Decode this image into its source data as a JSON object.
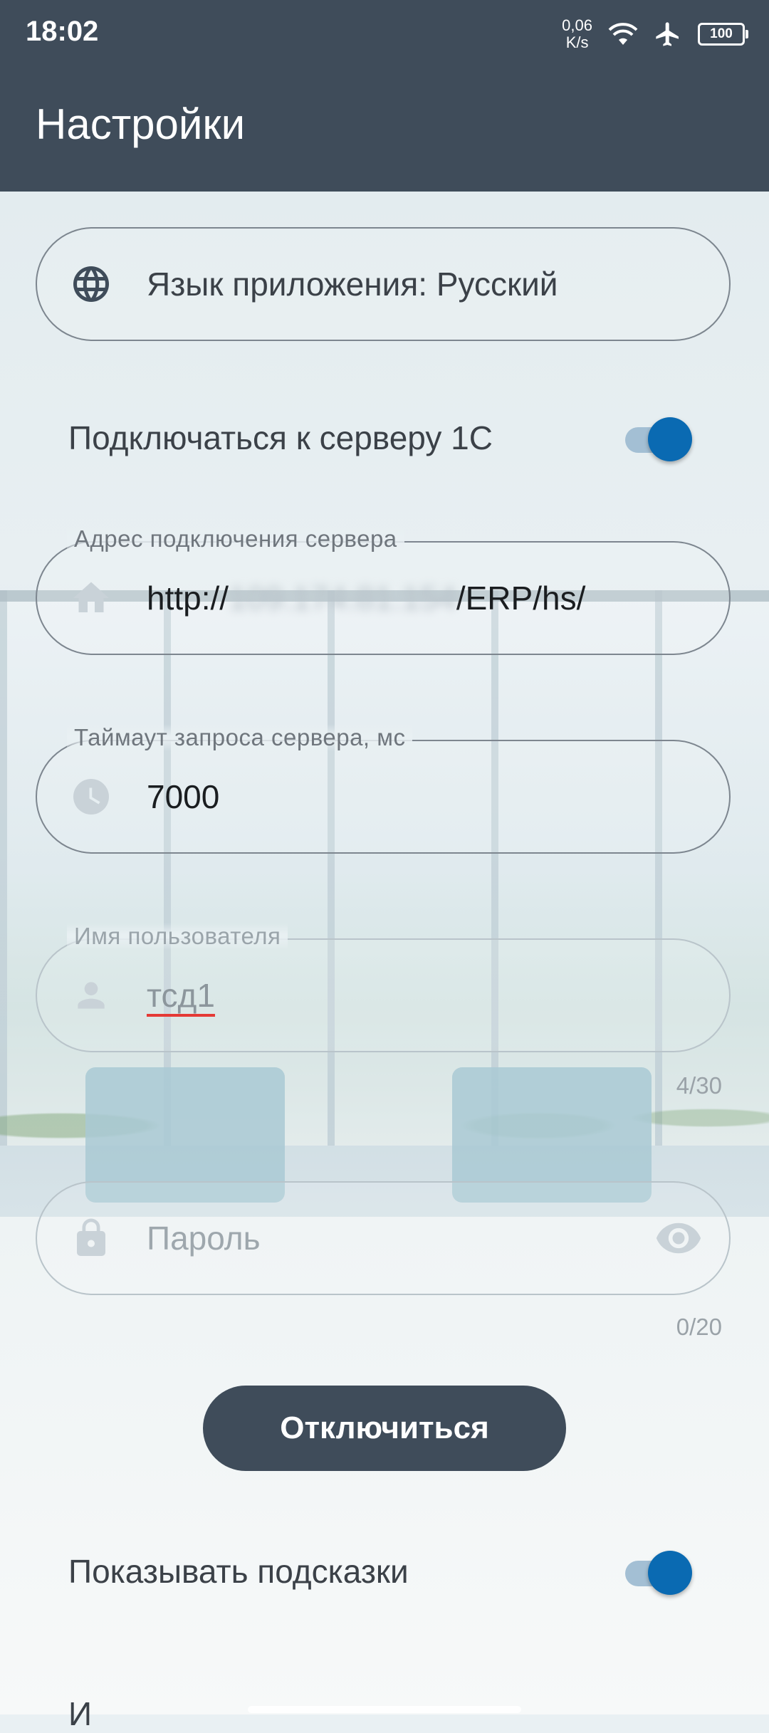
{
  "status_bar": {
    "time": "18:02",
    "speed_value": "0,06",
    "speed_unit": "K/s",
    "battery": "100",
    "icons": [
      "wifi-icon",
      "airplane-mode-icon",
      "battery-icon"
    ]
  },
  "app_bar": {
    "title": "Настройки"
  },
  "language": {
    "label": "Язык приложения: Русский",
    "icon": "globe-icon"
  },
  "connect_1c": {
    "label": "Подключаться к серверу 1С",
    "enabled": true
  },
  "server_address": {
    "label": "Адрес подключения сервера",
    "value_prefix": "http://",
    "value_hidden": "109.174.81.154",
    "value_suffix": "/ERP/hs/",
    "icon": "home-icon"
  },
  "timeout": {
    "label": "Таймаут запроса сервера, мс",
    "value": "7000",
    "icon": "clock-icon"
  },
  "username": {
    "label": "Имя пользователя",
    "value": "тсд1",
    "counter": "4/30",
    "icon": "person-icon"
  },
  "password": {
    "placeholder": "Пароль",
    "counter": "0/20",
    "icon": "lock-icon",
    "toggle_icon": "eye-icon"
  },
  "disconnect_button": {
    "label": "Отключиться"
  },
  "show_hints": {
    "label": "Показывать подсказки",
    "enabled": true
  },
  "next_item_partial": "И",
  "colors": {
    "app_bar": "#3f4c5a",
    "accent": "#0a6ab2",
    "button": "#3f4c5a"
  }
}
